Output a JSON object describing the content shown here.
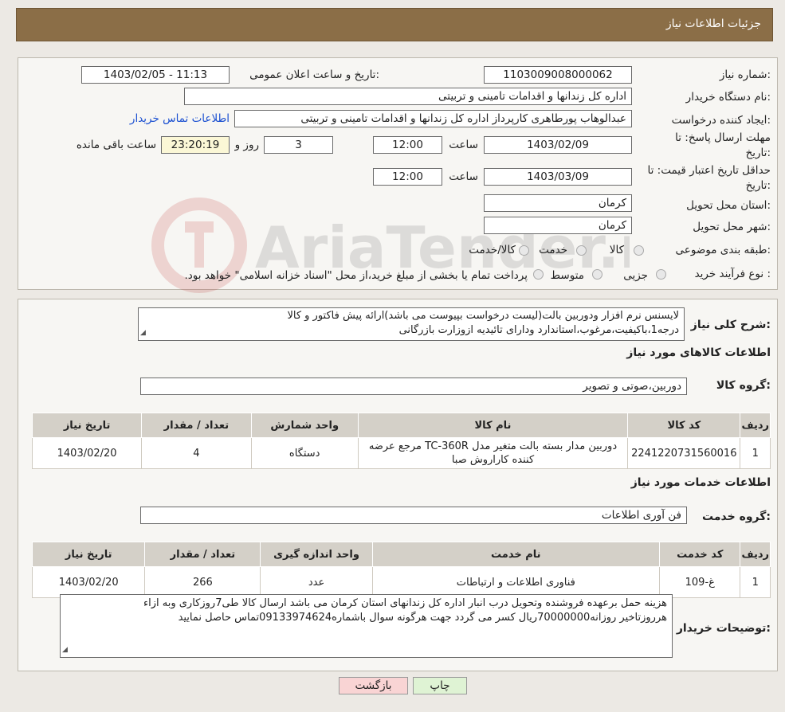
{
  "header": {
    "title": "جزئیات اطلاعات نیاز"
  },
  "form": {
    "need_number_label": "شماره نیاز:",
    "need_number": "1103009008000062",
    "announce_label": "تاریخ و ساعت اعلان عمومی:",
    "announce_value": "1403/02/05 - 11:13",
    "buyer_org_label": "نام دستگاه خریدار:",
    "buyer_org": "اداره کل زندانها و اقدامات تامینی و تربیتی",
    "creator_label": "ایجاد کننده درخواست:",
    "creator": "عبدالوهاب پورطاهری کارپرداز اداره کل زندانها و اقدامات تامینی و تربیتی",
    "contact_link": "اطلاعات تماس خریدار",
    "deadline_label_1": "مهلت ارسال پاسخ: تا",
    "deadline_label_2": "تاریخ:",
    "deadline_date": "1403/02/09",
    "time_label": "ساعت",
    "deadline_time": "12:00",
    "days_value": "3",
    "days_label": "روز و",
    "remaining_time": "23:20:19",
    "remaining_label": "ساعت باقی مانده",
    "validity_label_1": "حداقل تاریخ اعتبار قیمت: تا",
    "validity_label_2": "تاریخ:",
    "validity_date": "1403/03/09",
    "validity_time": "12:00",
    "province_label": "استان محل تحویل:",
    "province": "کرمان",
    "city_label": "شهر محل تحویل:",
    "city": "کرمان",
    "category_label": "طبقه بندی موضوعی:",
    "category_options": [
      "کالا",
      "خدمت",
      "کالا/خدمت"
    ],
    "process_label": "نوع فرآیند خرید :",
    "process_options": [
      "جزیی",
      "متوسط"
    ],
    "process_note": "پرداخت تمام یا بخشی از مبلغ خرید،از محل \"اسناد خزانه اسلامی\" خواهد بود."
  },
  "description": {
    "label": "شرح کلی نیاز:",
    "line1": "لایسنس نرم افزار ودوربین بالت(لیست درخواست بپیوست می باشد)ارائه پیش فاکتور و کالا",
    "line2": "درجه1،باکیفیت،مرغوب،استاندارد ودارای تائیدیه ازوزارت بازرگانی"
  },
  "goods": {
    "section_title": "اطلاعات کالاهای مورد نیاز",
    "group_label": "گروه کالا:",
    "group_value": "دوربین،صوتی و تصویر",
    "headers": [
      "ردیف",
      "کد کالا",
      "نام کالا",
      "واحد شمارش",
      "تعداد / مقدار",
      "تاریخ نیاز"
    ],
    "rows": [
      [
        "1",
        "2241220731560016",
        "دوربین مدار بسته بالت متغیر مدل TC-360R مرجع عرضه کننده کاراروش صبا",
        "دستگاه",
        "4",
        "1403/02/20"
      ]
    ]
  },
  "services": {
    "section_title": "اطلاعات خدمات مورد نیاز",
    "group_label": "گروه خدمت:",
    "group_value": "فن آوری اطلاعات",
    "headers": [
      "ردیف",
      "کد خدمت",
      "نام خدمت",
      "واحد اندازه گیری",
      "تعداد / مقدار",
      "تاریخ نیاز"
    ],
    "rows": [
      [
        "1",
        "غ-109",
        "فناوری اطلاعات و ارتباطات",
        "عدد",
        "266",
        "1403/02/20"
      ]
    ]
  },
  "buyer_notes": {
    "label": "توضیحات خریدار:",
    "line1": "هزینه حمل برعهده فروشنده وتحویل درب انبار اداره کل زندانهای استان کرمان می باشد ارسال کالا طی7روزکاری وبه ازاء",
    "line2": "هرروزتاخیر روزانه70000000ریال کسر می گردد جهت هرگونه سوال باشماره09133974624تماس حاصل نمایید"
  },
  "buttons": {
    "print": "چاپ",
    "back": "بازگشت"
  },
  "watermark": "AriaTender.neT",
  "colors": {
    "header_bg": "#8b6e47",
    "link": "#1a4fd1",
    "back_button": "#f9d4d4",
    "print_button": "#dff3d4"
  }
}
